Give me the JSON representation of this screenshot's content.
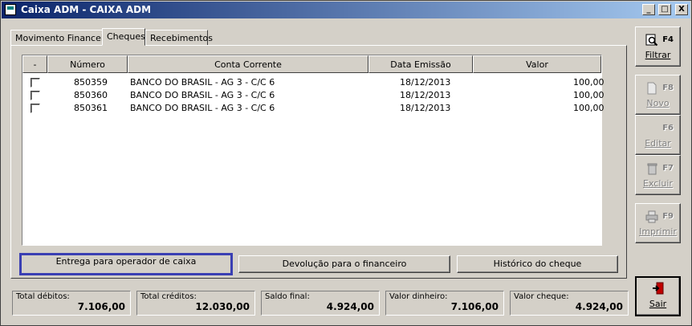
{
  "window": {
    "title": "Caixa ADM - CAIXA ADM",
    "minimize": "_",
    "maximize": "□",
    "close": "X"
  },
  "tabs": [
    {
      "label": "Movimento Financeiro"
    },
    {
      "label": "Cheques"
    },
    {
      "label": "Recebimentos"
    }
  ],
  "grid": {
    "columns": [
      "-",
      "Número",
      "Conta Corrente",
      "Data Emissão",
      "Valor"
    ],
    "rows": [
      {
        "numero": "850359",
        "conta": "BANCO DO BRASIL - AG 3 - C/C 6",
        "data": "18/12/2013",
        "valor": "100,00"
      },
      {
        "numero": "850360",
        "conta": "BANCO DO BRASIL - AG 3 - C/C 6",
        "data": "18/12/2013",
        "valor": "100,00"
      },
      {
        "numero": "850361",
        "conta": "BANCO DO BRASIL - AG 3 - C/C 6",
        "data": "18/12/2013",
        "valor": "100,00"
      }
    ]
  },
  "actions": {
    "entrega": "Entrega para operador de caixa",
    "devolucao": "Devolução para o financeiro",
    "historico": "Histórico do cheque"
  },
  "side": {
    "filtrar": {
      "key": "F4",
      "label": "Filtrar",
      "icon": "magnifier-icon"
    },
    "novo": {
      "key": "F8",
      "label": "Novo",
      "icon": "new-document-icon"
    },
    "editar": {
      "key": "F6",
      "label": "Editar",
      "icon": "edit-icon"
    },
    "excluir": {
      "key": "F7",
      "label": "Excluir",
      "icon": "trash-icon"
    },
    "imprimir": {
      "key": "F9",
      "label": "Imprimir",
      "icon": "printer-icon"
    },
    "sair": {
      "label": "Sair",
      "icon": "exit-door-icon"
    }
  },
  "totals": [
    {
      "label": "Total débitos:",
      "value": "7.106,00"
    },
    {
      "label": "Total créditos:",
      "value": "12.030,00"
    },
    {
      "label": "Saldo final:",
      "value": "4.924,00"
    },
    {
      "label": "Valor dinheiro:",
      "value": "7.106,00"
    },
    {
      "label": "Valor cheque:",
      "value": "4.924,00"
    }
  ],
  "colors": {
    "titlebar_start": "#0a246a",
    "titlebar_end": "#a6caf0",
    "focus_border": "#3a3fb3",
    "face": "#d4d0c8"
  }
}
